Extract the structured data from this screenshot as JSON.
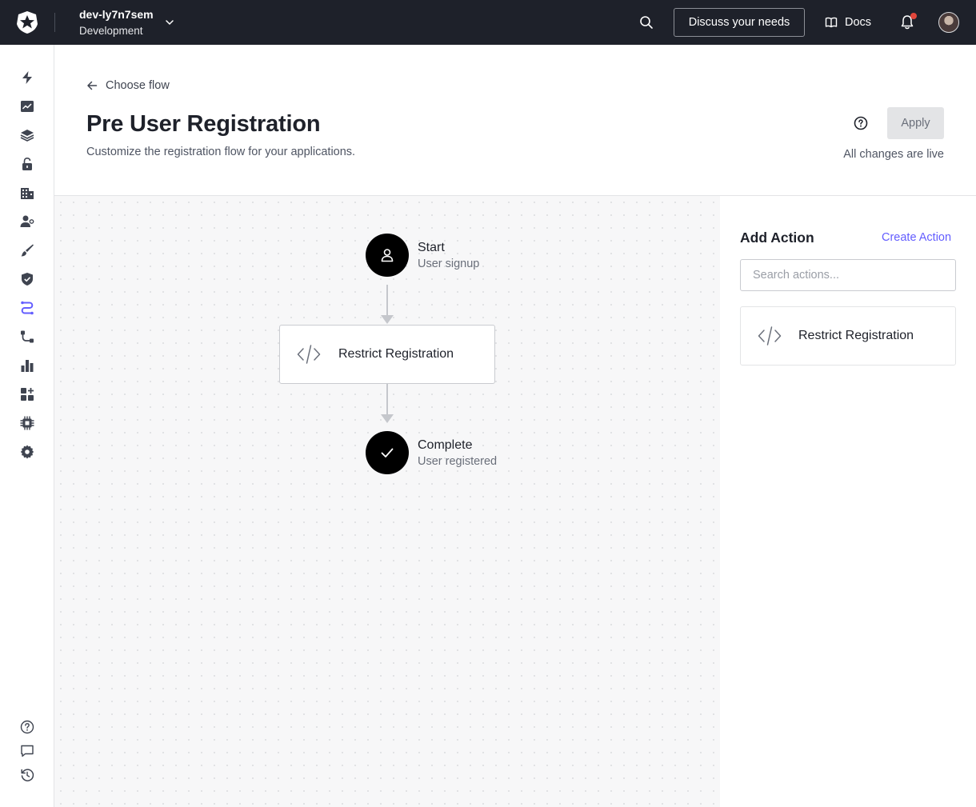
{
  "topbar": {
    "tenant_name": "dev-ly7n7sem",
    "tenant_env": "Development",
    "discuss_label": "Discuss your needs",
    "docs_label": "Docs",
    "notification_dot_color": "#e2463b"
  },
  "sidebar": {
    "items": [
      {
        "icon": "lightning-icon"
      },
      {
        "icon": "activity-chart-icon"
      },
      {
        "icon": "layers-icon"
      },
      {
        "icon": "lock-icon"
      },
      {
        "icon": "organizations-icon"
      },
      {
        "icon": "user-management-icon"
      },
      {
        "icon": "brush-icon"
      },
      {
        "icon": "shield-icon"
      },
      {
        "icon": "actions-flow-icon"
      },
      {
        "icon": "pipeline-icon"
      },
      {
        "icon": "bar-chart-icon"
      },
      {
        "icon": "marketplace-icon"
      },
      {
        "icon": "chip-icon"
      },
      {
        "icon": "gear-icon"
      }
    ],
    "footer": [
      {
        "icon": "help-icon"
      },
      {
        "icon": "feedback-icon"
      },
      {
        "icon": "history-icon"
      }
    ]
  },
  "header": {
    "back_label": "Choose flow",
    "title": "Pre User Registration",
    "subtitle": "Customize the registration flow for your applications.",
    "apply_label": "Apply",
    "status": "All changes are live"
  },
  "flow": {
    "start_title": "Start",
    "start_sub": "User signup",
    "action_label": "Restrict Registration",
    "end_title": "Complete",
    "end_sub": "User registered"
  },
  "panel": {
    "title": "Add Action",
    "create_label": "Create Action",
    "search_placeholder": "Search actions...",
    "actions": [
      {
        "label": "Restrict Registration"
      }
    ]
  },
  "colors": {
    "topbar_bg": "#1e212a",
    "accent": "#635dff",
    "active_nav": "#635dff"
  }
}
